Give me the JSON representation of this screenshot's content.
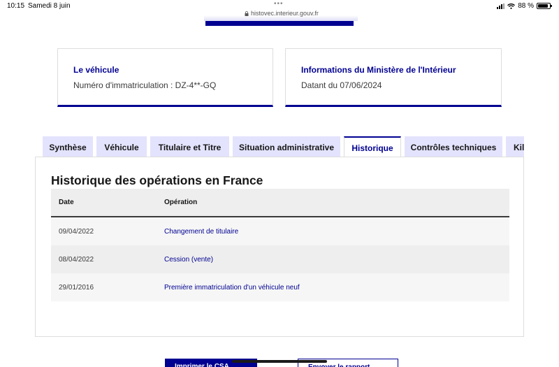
{
  "statusbar": {
    "time": "10:15",
    "date": "Samedi 8 juin",
    "dots": "•••",
    "url": "histovec.interieur.gouv.fr",
    "battery": "88 %",
    "battery_level": 0.88
  },
  "cards": [
    {
      "title": "Le véhicule",
      "value": "Numéro d'immatriculation : DZ-4**-GQ"
    },
    {
      "title": "Informations du Ministère de l'Intérieur",
      "value": "Datant du 07/06/2024"
    }
  ],
  "tabs": [
    {
      "label": "Synthèse",
      "active": false
    },
    {
      "label": "Véhicule",
      "active": false
    },
    {
      "label": "Titulaire et Titre",
      "active": false
    },
    {
      "label": "Situation administrative",
      "active": false
    },
    {
      "label": "Historique",
      "active": true
    },
    {
      "label": "Contrôles techniques",
      "active": false
    },
    {
      "label": "Kilométrage",
      "active": false
    }
  ],
  "historique": {
    "title": "Historique des opérations en France",
    "columns": {
      "date": "Date",
      "operation": "Opération"
    },
    "rows": [
      {
        "date": "09/04/2022",
        "operation": "Changement de titulaire"
      },
      {
        "date": "08/04/2022",
        "operation": "Cession (vente)"
      },
      {
        "date": "29/01/2016",
        "operation": "Première immatriculation d'un véhicule neuf"
      }
    ]
  },
  "bottom": {
    "button_left": "Imprimer le CSA",
    "button_right": "Envoyer le rapport"
  },
  "colors": {
    "brand": "#000091",
    "tab_bg": "#e3e3fd"
  }
}
